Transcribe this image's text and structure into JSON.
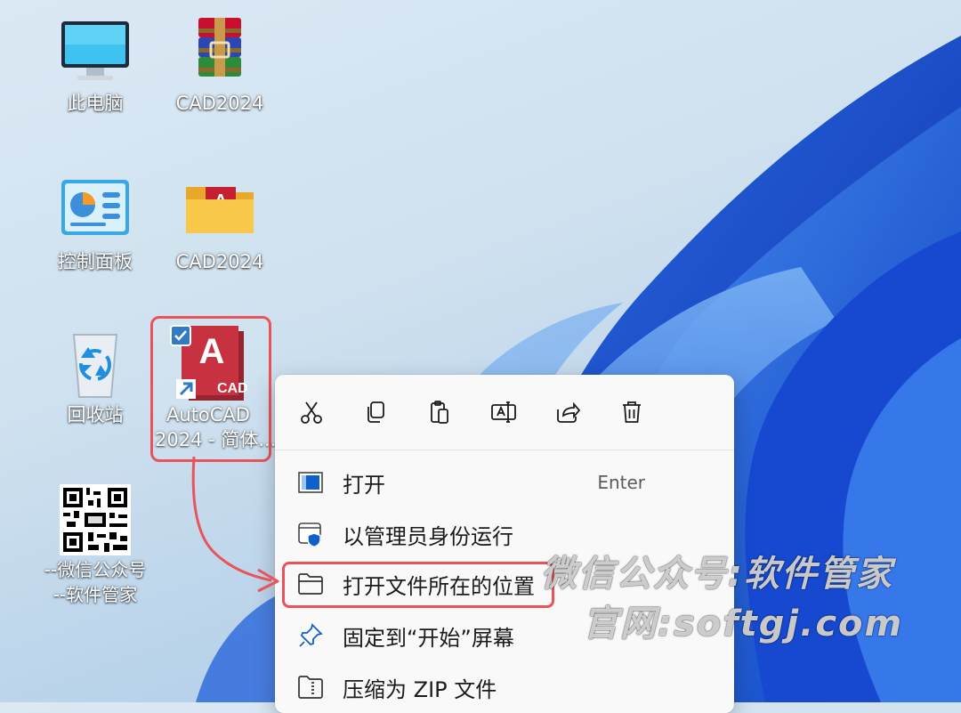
{
  "desktop": {
    "icons": [
      {
        "label": "此电脑"
      },
      {
        "label": "CAD2024"
      },
      {
        "label": "控制面板"
      },
      {
        "label": "CAD2024"
      },
      {
        "label": "回收站"
      },
      {
        "label_line1": "AutoCAD",
        "label_line2": "2024 - 简体...",
        "badge": "CAD"
      },
      {
        "label_line1": "--微信公众号",
        "label_line2": "--软件管家"
      }
    ]
  },
  "context_menu": {
    "toolbar": [
      {
        "icon": "cut-icon"
      },
      {
        "icon": "copy-icon"
      },
      {
        "icon": "paste-icon"
      },
      {
        "icon": "rename-icon"
      },
      {
        "icon": "share-icon"
      },
      {
        "icon": "delete-icon"
      }
    ],
    "items": [
      {
        "label": "打开",
        "shortcut": "Enter",
        "icon": "open-icon"
      },
      {
        "label": "以管理员身份运行",
        "icon": "shield-icon"
      },
      {
        "label": "打开文件所在的位置",
        "icon": "folder-icon"
      },
      {
        "label": "固定到“开始”屏幕",
        "icon": "pin-icon"
      },
      {
        "label": "压缩为 ZIP 文件",
        "icon": "zip-icon"
      }
    ]
  },
  "watermark": {
    "line1": "微信公众号:软件管家",
    "line2": "官网:softgj.com"
  },
  "colors": {
    "highlight": "#e9545a",
    "autocad_red": "#c4202f"
  }
}
